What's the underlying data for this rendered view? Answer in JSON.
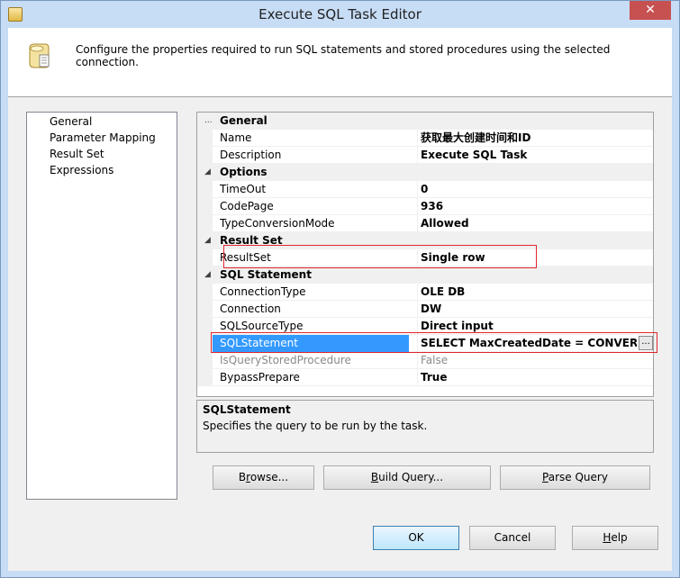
{
  "window": {
    "title": "Execute SQL Task Editor"
  },
  "header": {
    "description": "Configure the properties required to run SQL statements and stored procedures using the selected connection."
  },
  "nav": {
    "items": [
      {
        "label": "General"
      },
      {
        "label": "Parameter Mapping"
      },
      {
        "label": "Result Set"
      },
      {
        "label": "Expressions"
      }
    ]
  },
  "grid": {
    "categories": [
      {
        "label": "General",
        "props": [
          {
            "name": "Name",
            "value": "获取最大创建时间和ID"
          },
          {
            "name": "Description",
            "value": "Execute SQL Task"
          }
        ]
      },
      {
        "label": "Options",
        "props": [
          {
            "name": "TimeOut",
            "value": "0"
          },
          {
            "name": "CodePage",
            "value": "936"
          },
          {
            "name": "TypeConversionMode",
            "value": "Allowed"
          }
        ]
      },
      {
        "label": "Result Set",
        "props": [
          {
            "name": "ResultSet",
            "value": "Single row"
          }
        ]
      },
      {
        "label": "SQL Statement",
        "props": [
          {
            "name": "ConnectionType",
            "value": "OLE DB"
          },
          {
            "name": "Connection",
            "value": "DW"
          },
          {
            "name": "SQLSourceType",
            "value": "Direct input"
          },
          {
            "name": "SQLStatement",
            "value": "SELECT  MaxCreatedDate = CONVERT(NVARCHAR"
          },
          {
            "name": "IsQueryStoredProcedure",
            "value": "False"
          },
          {
            "name": "BypassPrepare",
            "value": "True"
          }
        ]
      }
    ],
    "ellipsis": "...",
    "collapse_glyph": "◢"
  },
  "description_pane": {
    "title": "SQLStatement",
    "text": "Specifies the query to be run by the task."
  },
  "buttons": {
    "browse": {
      "mnemonic": "r",
      "pre": "B",
      "post": "owse..."
    },
    "build_query": {
      "mnemonic": "B",
      "pre": "",
      "post": "uild Query..."
    },
    "parse_query": {
      "mnemonic": "P",
      "pre": "",
      "post": "arse Query"
    },
    "ok": "OK",
    "cancel": "Cancel",
    "help": {
      "mnemonic": "H",
      "pre": "",
      "post": "elp"
    }
  },
  "close_glyph": "✕",
  "colors": {
    "selection": "#3399ff",
    "highlight_box": "#e0262c",
    "titlebar": "#c7dcf5"
  }
}
